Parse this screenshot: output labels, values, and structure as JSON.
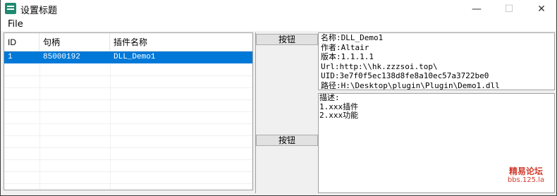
{
  "window": {
    "title": "设置标题",
    "controls": {
      "minimize": "—",
      "maximize": "☐",
      "close": "✕"
    }
  },
  "menu": {
    "file": "File"
  },
  "list": {
    "columns": [
      "ID",
      "句柄",
      "插件名称"
    ],
    "rows": [
      [
        "1",
        "85000192",
        "DLL_Demo1"
      ]
    ]
  },
  "buttons": {
    "top": "按钮",
    "bottom": "按钮"
  },
  "info": {
    "name": "名称:DLL_Demo1",
    "author": "作者:Altair",
    "version": "版本:1.1.1.1",
    "url": "Url:http:\\\\hk.zzzsoi.top\\",
    "uid": "UID:3e7f0f5ec138d8fe8a10ec57a3722be0",
    "path": "路径:H:\\Desktop\\plugin\\Plugin\\Demo1.dll"
  },
  "description": {
    "label": "描述:",
    "line1": "1.xxx插件",
    "line2": "2.xxx功能"
  },
  "watermark": {
    "line1": "精易论坛",
    "line2": "bbs.125.la"
  },
  "colors": {
    "selection": "#0078d7",
    "watermark": "#d23b2e"
  }
}
